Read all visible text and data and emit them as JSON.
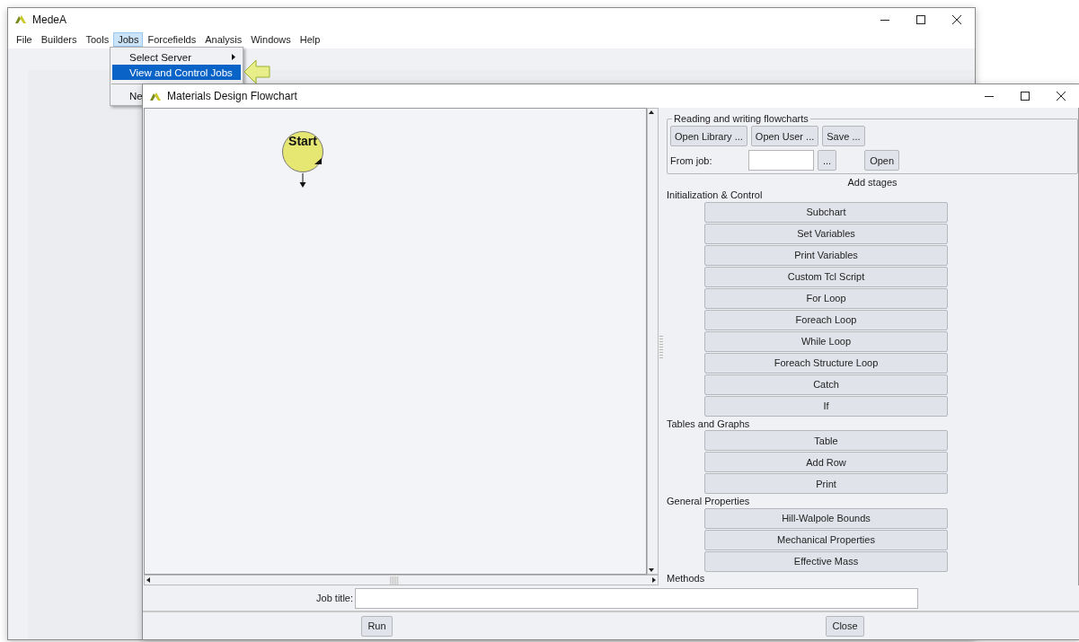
{
  "main_window": {
    "title": "MedeA",
    "menu": [
      {
        "label": "File",
        "selected": false
      },
      {
        "label": "Builders",
        "selected": false
      },
      {
        "label": "Tools",
        "selected": false
      },
      {
        "label": "Jobs",
        "selected": true
      },
      {
        "label": "Forcefields",
        "selected": false
      },
      {
        "label": "Analysis",
        "selected": false
      },
      {
        "label": "Windows",
        "selected": false
      },
      {
        "label": "Help",
        "selected": false
      }
    ],
    "open_menu": {
      "items": [
        {
          "label": "Select Server",
          "submenu": true,
          "separator_before": false,
          "selected": false
        },
        {
          "label": "View and Control Jobs",
          "submenu": false,
          "separator_before": false,
          "selected": true
        },
        {
          "label": "Ne",
          "submenu": false,
          "separator_before": true,
          "selected": false
        }
      ]
    }
  },
  "flowchart_window": {
    "title": "Materials Design Flowchart",
    "canvas": {
      "start_node": "Start"
    },
    "reading_group": {
      "title": "Reading and writing flowcharts",
      "buttons": [
        "Open Library ...",
        "Open User ...",
        "Save ..."
      ],
      "from_job_label": "From job:",
      "browse_button": "...",
      "open_button": "Open"
    },
    "add_stages_heading": "Add stages",
    "sections": [
      {
        "title": "Initialization & Control",
        "stages": [
          "Subchart",
          "Set Variables",
          "Print Variables",
          "Custom Tcl Script",
          "For Loop",
          "Foreach Loop",
          "While Loop",
          "Foreach Structure Loop",
          "Catch",
          "If"
        ]
      },
      {
        "title": "Tables and Graphs",
        "stages": [
          "Table",
          "Add Row",
          "Print"
        ]
      },
      {
        "title": "General Properties",
        "stages": [
          "Hill-Walpole Bounds",
          "Mechanical Properties",
          "Effective Mass"
        ]
      },
      {
        "title": "Methods"
      }
    ],
    "job_title_label": "Job title:",
    "buttons": [
      "Run",
      "Close"
    ]
  }
}
